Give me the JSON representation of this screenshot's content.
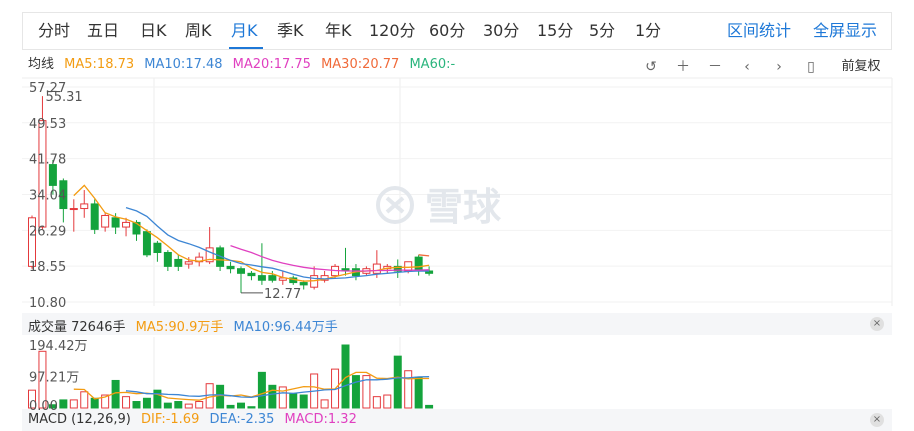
{
  "tabs": [
    {
      "label": "分时",
      "active": false
    },
    {
      "label": "五日",
      "active": false
    },
    {
      "label": "日K",
      "active": false
    },
    {
      "label": "周K",
      "active": false
    },
    {
      "label": "月K",
      "active": true
    },
    {
      "label": "季K",
      "active": false
    },
    {
      "label": "年K",
      "active": false
    },
    {
      "label": "120分",
      "active": false
    },
    {
      "label": "60分",
      "active": false
    },
    {
      "label": "30分",
      "active": false
    },
    {
      "label": "15分",
      "active": false
    },
    {
      "label": "5分",
      "active": false
    },
    {
      "label": "1分",
      "active": false
    }
  ],
  "right_links": {
    "interval_stats": "区间统计",
    "fullscreen": "全屏显示"
  },
  "ma_row": {
    "title": "均线",
    "ma5": "MA5:18.73",
    "ma10": "MA10:17.48",
    "ma20": "MA20:17.75",
    "ma30": "MA30:20.77",
    "ma60": "MA60:-"
  },
  "toolbar": {
    "adjust": "前复权"
  },
  "volume_row": {
    "title": "成交量 72646手",
    "ma5": "MA5:90.9万手",
    "ma10": "MA10:96.44万手"
  },
  "macd_row": {
    "title": "MACD (12,26,9)",
    "dif": "DIF:-1.69",
    "dea": "DEA:-2.35",
    "macd": "MACD:1.32"
  },
  "watermark": {
    "text": "雪球"
  },
  "colors": {
    "up": "#e4393c",
    "down": "#14a33c",
    "accent": "#1e78d7",
    "ma5": "#f39c12",
    "ma10": "#3d86d4",
    "ma20": "#e040c0",
    "ma30": "#f06a3a",
    "ma60": "#2ab57d"
  },
  "chart_data": {
    "type": "candlestick",
    "price_axis": {
      "ticks": [
        "57.27",
        "49.53",
        "41.78",
        "34.04",
        "26.29",
        "18.55",
        "10.80"
      ],
      "ylim": [
        10.8,
        57.27
      ]
    },
    "annotations": {
      "high_label": "55.31",
      "high_value": 55.31,
      "low_label": "12.77",
      "low_value": 12.77
    },
    "candles": [
      {
        "o": 18.5,
        "c": 29.0,
        "h": 29.5,
        "l": 18.0
      },
      {
        "o": 27.0,
        "c": 50.0,
        "h": 55.31,
        "l": 26.5
      },
      {
        "o": 40.5,
        "c": 36.0,
        "h": 41.5,
        "l": 34.0
      },
      {
        "o": 37.0,
        "c": 31.0,
        "h": 37.5,
        "l": 28.0
      },
      {
        "o": 31.0,
        "c": 31.0,
        "h": 33.0,
        "l": 26.0
      },
      {
        "o": 31.0,
        "c": 32.0,
        "h": 35.0,
        "l": 29.0
      },
      {
        "o": 32.0,
        "c": 26.5,
        "h": 33.0,
        "l": 25.5
      },
      {
        "o": 27.0,
        "c": 29.5,
        "h": 30.0,
        "l": 26.0
      },
      {
        "o": 29.0,
        "c": 27.0,
        "h": 30.0,
        "l": 25.5
      },
      {
        "o": 27.0,
        "c": 28.0,
        "h": 29.0,
        "l": 25.0
      },
      {
        "o": 28.0,
        "c": 25.5,
        "h": 28.5,
        "l": 24.0
      },
      {
        "o": 26.0,
        "c": 21.0,
        "h": 26.5,
        "l": 20.5
      },
      {
        "o": 23.5,
        "c": 21.5,
        "h": 24.0,
        "l": 19.5
      },
      {
        "o": 21.5,
        "c": 18.5,
        "h": 22.0,
        "l": 17.5
      },
      {
        "o": 20.0,
        "c": 18.5,
        "h": 21.0,
        "l": 17.5
      },
      {
        "o": 19.0,
        "c": 19.5,
        "h": 20.5,
        "l": 18.0
      },
      {
        "o": 19.5,
        "c": 20.5,
        "h": 21.5,
        "l": 18.5
      },
      {
        "o": 19.5,
        "c": 22.5,
        "h": 27.0,
        "l": 19.0
      },
      {
        "o": 22.5,
        "c": 18.5,
        "h": 23.0,
        "l": 17.5
      },
      {
        "o": 18.5,
        "c": 18.0,
        "h": 19.5,
        "l": 17.0
      },
      {
        "o": 18.0,
        "c": 17.0,
        "h": 18.5,
        "l": 12.77
      },
      {
        "o": 17.0,
        "c": 16.5,
        "h": 17.5,
        "l": 15.5
      },
      {
        "o": 16.5,
        "c": 15.5,
        "h": 23.5,
        "l": 14.5
      },
      {
        "o": 16.5,
        "c": 15.5,
        "h": 17.5,
        "l": 15.0
      },
      {
        "o": 15.5,
        "c": 16.0,
        "h": 17.5,
        "l": 14.5
      },
      {
        "o": 16.0,
        "c": 15.0,
        "h": 16.5,
        "l": 14.5
      },
      {
        "o": 15.0,
        "c": 14.5,
        "h": 15.5,
        "l": 13.5
      },
      {
        "o": 14.0,
        "c": 16.5,
        "h": 18.5,
        "l": 13.5
      },
      {
        "o": 15.5,
        "c": 16.5,
        "h": 17.5,
        "l": 15.0
      },
      {
        "o": 16.5,
        "c": 18.5,
        "h": 19.0,
        "l": 16.0
      },
      {
        "o": 18.0,
        "c": 17.5,
        "h": 22.5,
        "l": 16.5
      },
      {
        "o": 18.0,
        "c": 16.5,
        "h": 19.0,
        "l": 15.5
      },
      {
        "o": 17.0,
        "c": 18.0,
        "h": 18.5,
        "l": 16.5
      },
      {
        "o": 17.0,
        "c": 19.0,
        "h": 22.0,
        "l": 16.0
      },
      {
        "o": 18.0,
        "c": 18.5,
        "h": 19.0,
        "l": 17.0
      },
      {
        "o": 18.5,
        "c": 17.5,
        "h": 20.0,
        "l": 16.0
      },
      {
        "o": 17.5,
        "c": 19.5,
        "h": 19.5,
        "l": 17.0
      },
      {
        "o": 20.5,
        "c": 17.5,
        "h": 21.0,
        "l": 16.5
      },
      {
        "o": 17.5,
        "c": 17.0,
        "h": 18.5,
        "l": 16.5
      }
    ],
    "ma_lines": [
      {
        "name": "MA5",
        "color": "#f39c12",
        "values": [
          null,
          null,
          null,
          null,
          33.8,
          36.0,
          33.2,
          30.1,
          29.2,
          28.7,
          27.8,
          26.2,
          24.7,
          22.9,
          21.0,
          19.9,
          19.6,
          20.0,
          19.9,
          19.8,
          19.5,
          18.1,
          17.2,
          16.9,
          16.1,
          15.7,
          15.3,
          15.4,
          15.7,
          16.3,
          16.8,
          17.3,
          17.5,
          17.6,
          18.1,
          18.3,
          18.3,
          18.4,
          18.73
        ]
      },
      {
        "name": "MA10",
        "color": "#3d86d4",
        "values": [
          null,
          null,
          null,
          null,
          null,
          null,
          null,
          null,
          null,
          31.2,
          30.5,
          29.3,
          27.2,
          25.3,
          24.1,
          23.4,
          22.6,
          21.6,
          20.7,
          19.8,
          19.1,
          18.8,
          18.4,
          18.1,
          17.5,
          16.8,
          16.2,
          15.9,
          15.8,
          15.9,
          16.0,
          16.3,
          16.5,
          16.8,
          17.0,
          17.2,
          17.4,
          17.5,
          17.48
        ]
      },
      {
        "name": "MA20",
        "color": "#e040c0",
        "values": [
          null,
          null,
          null,
          null,
          null,
          null,
          null,
          null,
          null,
          null,
          null,
          null,
          null,
          null,
          null,
          null,
          null,
          null,
          null,
          23.0,
          22.2,
          21.5,
          20.6,
          19.8,
          19.2,
          18.7,
          18.3,
          18.0,
          17.8,
          17.6,
          17.5,
          17.5,
          17.5,
          17.6,
          17.6,
          17.7,
          17.7,
          17.7,
          17.75
        ]
      },
      {
        "name": "MA30",
        "color": "#f06a3a",
        "values": [
          null,
          null,
          null,
          null,
          null,
          null,
          null,
          null,
          null,
          null,
          null,
          null,
          null,
          null,
          null,
          null,
          null,
          null,
          null,
          null,
          null,
          null,
          null,
          null,
          null,
          null,
          null,
          null,
          null,
          null,
          null,
          null,
          null,
          null,
          null,
          null,
          null,
          21.0,
          20.77
        ]
      },
      {
        "name": "MA60",
        "color": "#2ab57d",
        "values": []
      }
    ],
    "volume": {
      "ticks": [
        "194.42万",
        "97.21万",
        "0.00"
      ],
      "ylim": [
        0,
        194.42
      ],
      "bars": [
        55,
        175,
        10,
        25,
        25,
        50,
        30,
        40,
        85,
        35,
        20,
        30,
        55,
        15,
        20,
        12,
        20,
        75,
        70,
        8,
        15,
        4,
        110,
        70,
        65,
        45,
        40,
        105,
        25,
        120,
        200,
        100,
        100,
        35,
        40,
        160,
        115,
        95,
        8
      ],
      "ma5": [
        null,
        null,
        null,
        null,
        58,
        57,
        28,
        34,
        47,
        48,
        44,
        46,
        42,
        31,
        28,
        26,
        24,
        34,
        39,
        37,
        40,
        34,
        44,
        55,
        52,
        59,
        66,
        65,
        58,
        59,
        94,
        110,
        110,
        92,
        91,
        95,
        90,
        91,
        90.9
      ],
      "ma10": [
        null,
        null,
        null,
        null,
        null,
        null,
        null,
        null,
        null,
        53,
        50,
        44,
        44,
        42,
        41,
        37,
        36,
        40,
        41,
        38,
        34,
        33,
        38,
        43,
        47,
        45,
        49,
        52,
        56,
        57,
        69,
        80,
        87,
        87,
        89,
        93,
        93,
        96,
        96.44
      ]
    }
  }
}
